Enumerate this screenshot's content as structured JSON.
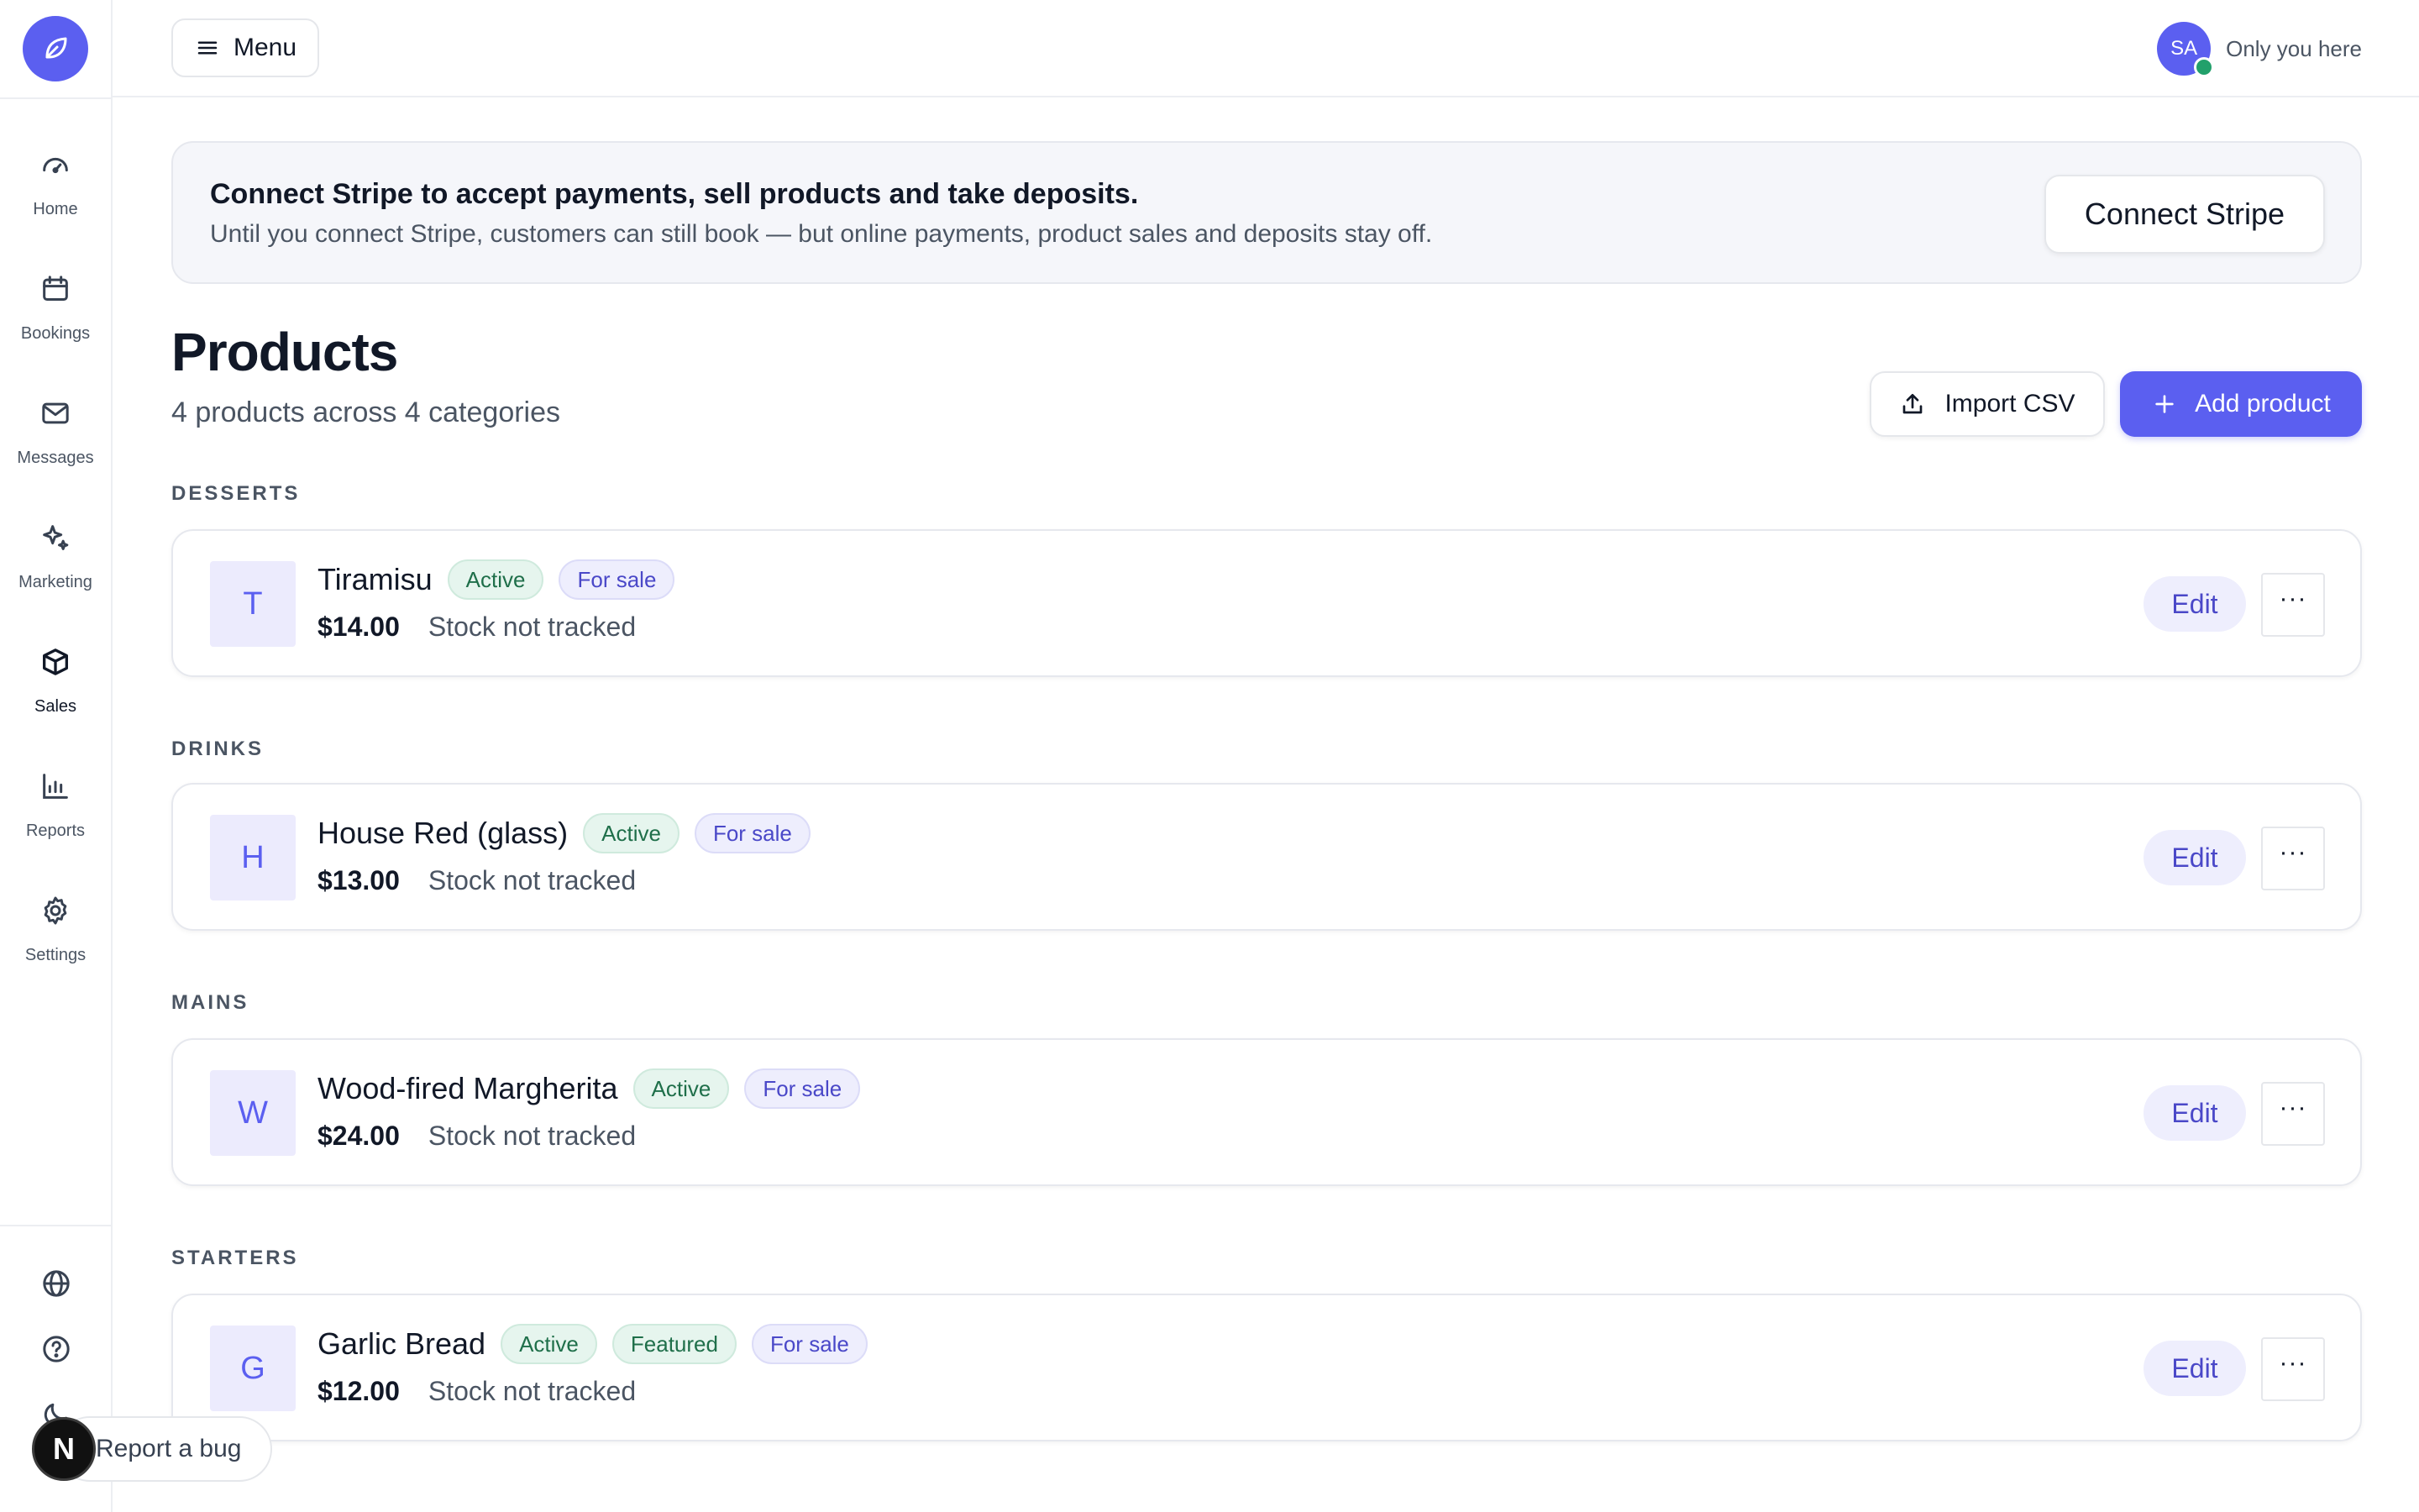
{
  "sidebar": {
    "items": [
      {
        "label": "Home",
        "icon": "gauge-icon"
      },
      {
        "label": "Bookings",
        "icon": "calendar-icon"
      },
      {
        "label": "Messages",
        "icon": "mail-icon"
      },
      {
        "label": "Marketing",
        "icon": "sparkle-icon"
      },
      {
        "label": "Sales",
        "icon": "box-icon",
        "active": true
      },
      {
        "label": "Reports",
        "icon": "bar-chart-icon"
      },
      {
        "label": "Settings",
        "icon": "gear-icon"
      }
    ]
  },
  "topbar": {
    "menu_label": "Menu",
    "avatar_initials": "SA",
    "presence_text": "Only you here"
  },
  "banner": {
    "title": "Connect Stripe to accept payments, sell products and take deposits.",
    "description": "Until you connect Stripe, customers can still book — but online payments, product sales and deposits stay off.",
    "button_label": "Connect Stripe"
  },
  "header": {
    "title": "Products",
    "subtitle": "4 products across 4 categories",
    "import_label": "Import CSV",
    "add_label": "Add product"
  },
  "categories": [
    {
      "name": "DESSERTS",
      "products": [
        {
          "initial": "T",
          "name": "Tiramisu",
          "badges": [
            "Active",
            "For sale"
          ],
          "price": "$14.00",
          "stock": "Stock not tracked"
        }
      ]
    },
    {
      "name": "DRINKS",
      "products": [
        {
          "initial": "H",
          "name": "House Red (glass)",
          "badges": [
            "Active",
            "For sale"
          ],
          "price": "$13.00",
          "stock": "Stock not tracked"
        }
      ]
    },
    {
      "name": "MAINS",
      "products": [
        {
          "initial": "W",
          "name": "Wood-fired Margherita",
          "badges": [
            "Active",
            "For sale"
          ],
          "price": "$24.00",
          "stock": "Stock not tracked"
        }
      ]
    },
    {
      "name": "STARTERS",
      "products": [
        {
          "initial": "G",
          "name": "Garlic Bread",
          "badges": [
            "Active",
            "Featured",
            "For sale"
          ],
          "price": "$12.00",
          "stock": "Stock not tracked"
        }
      ]
    }
  ],
  "actions": {
    "edit_label": "Edit",
    "more_label": "···"
  },
  "bug_report": {
    "badge": "N",
    "label": "Report a bug"
  },
  "colors": {
    "accent": "#5b5ff0",
    "active_badge": "#1f6f4a",
    "sale_badge": "#4a48c8"
  }
}
